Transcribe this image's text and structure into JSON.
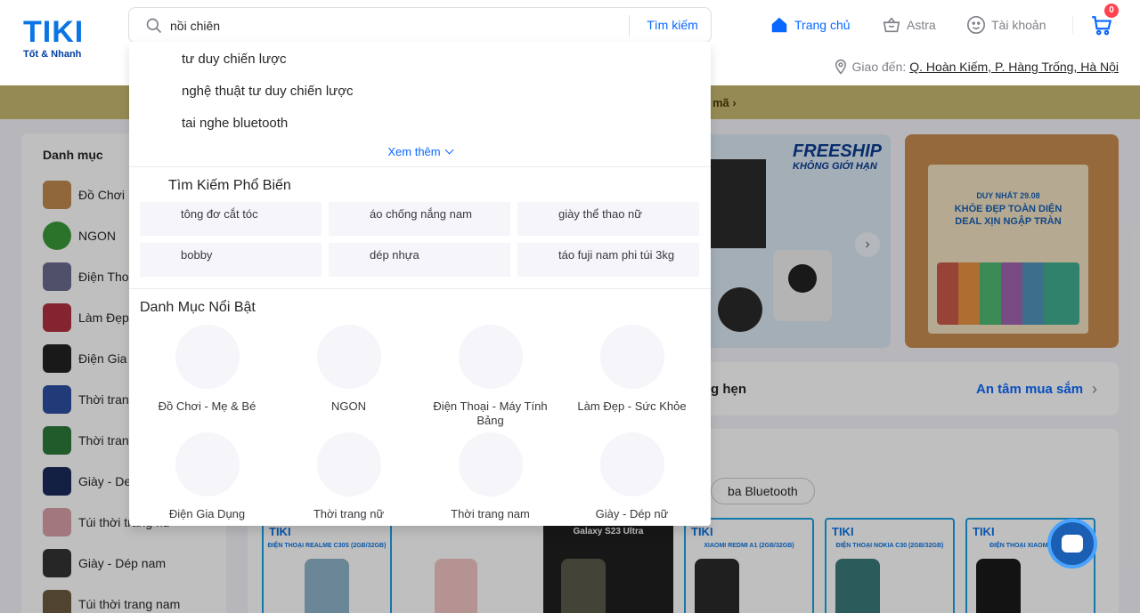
{
  "header": {
    "logo": {
      "text": "TIKI",
      "tagline": "Tốt & Nhanh"
    },
    "search": {
      "value": "nồi chiên",
      "placeholder": "",
      "button_label": "Tìm kiếm"
    },
    "nav": {
      "home": "Trang chủ",
      "astra": "Astra",
      "account": "Tài khoản"
    },
    "cart_count": "0",
    "delivery": {
      "label": "Giao đến:",
      "address": "Q. Hoàn Kiếm, P. Hàng Trống, Hà Nội"
    }
  },
  "promo_strip": {
    "text": "mã"
  },
  "search_dropdown": {
    "suggestions": [
      "tư duy chiến lược",
      "nghệ thuật tư duy chiến lược",
      "tai nghe bluetooth"
    ],
    "see_more": "Xem thêm",
    "popular_title": "Tìm Kiếm Phổ Biến",
    "popular_items": [
      "tông đơ cắt tóc",
      "áo chống nắng nam",
      "giày thể thao nữ",
      "bobby",
      "dép nhựa",
      "táo fuji nam phi túi 3kg"
    ],
    "categories_title": "Danh Mục Nổi Bật",
    "categories": [
      "Đồ Chơi - Mẹ & Bé",
      "NGON",
      "Điện Thoại - Máy Tính Bảng",
      "Làm Đẹp - Sức Khỏe",
      "Điện Gia Dụng",
      "Thời trang nữ",
      "Thời trang nam",
      "Giày - Dép nữ"
    ]
  },
  "sidebar": {
    "title": "Danh mục",
    "items": [
      "Đồ Chơi",
      "NGON",
      "Điện Thoại",
      "Làm Đẹp",
      "Điện Gia",
      "Thời tran",
      "Thời tran",
      "Giày - De",
      "Túi thời trang nữ",
      "Giày - Dép nam",
      "Túi thời trang nam"
    ]
  },
  "banners": {
    "freeship_title": "FREESHIP",
    "freeship_sub": "KHÔNG GIỚI HẠN",
    "pharma_line1": "DUY NHẤT 29.08",
    "pharma_line2": "KHỎE ĐẸP TOÀN DIỆN",
    "pharma_line3": "DEAL XỊN NGẬP TRÀN"
  },
  "trust_bar": {
    "left": "g hẹn",
    "right": "An tâm mua sắm"
  },
  "products": {
    "chip": "ba Bluetooth",
    "cards": [
      {
        "brand": "TIKI",
        "title": "ĐIỆN THOẠI REALME C30S (2GB/32GB)"
      },
      {
        "brand": "",
        "title": ""
      },
      {
        "brand": "",
        "title": "Galaxy S23 Ultra"
      },
      {
        "brand": "TIKI",
        "title": "XIAOMI REDMI A1 (2GB/32GB)"
      },
      {
        "brand": "TIKI",
        "title": "ĐIỆN THOẠI NOKIA C30 (2GB/32GB)"
      },
      {
        "brand": "TIKI",
        "title": "ĐIỆN THOẠI XIAOMI REDMI"
      }
    ]
  },
  "colors": {
    "brand": "#0a68ff",
    "badge": "#ff424f",
    "promo": "#c9b871"
  }
}
